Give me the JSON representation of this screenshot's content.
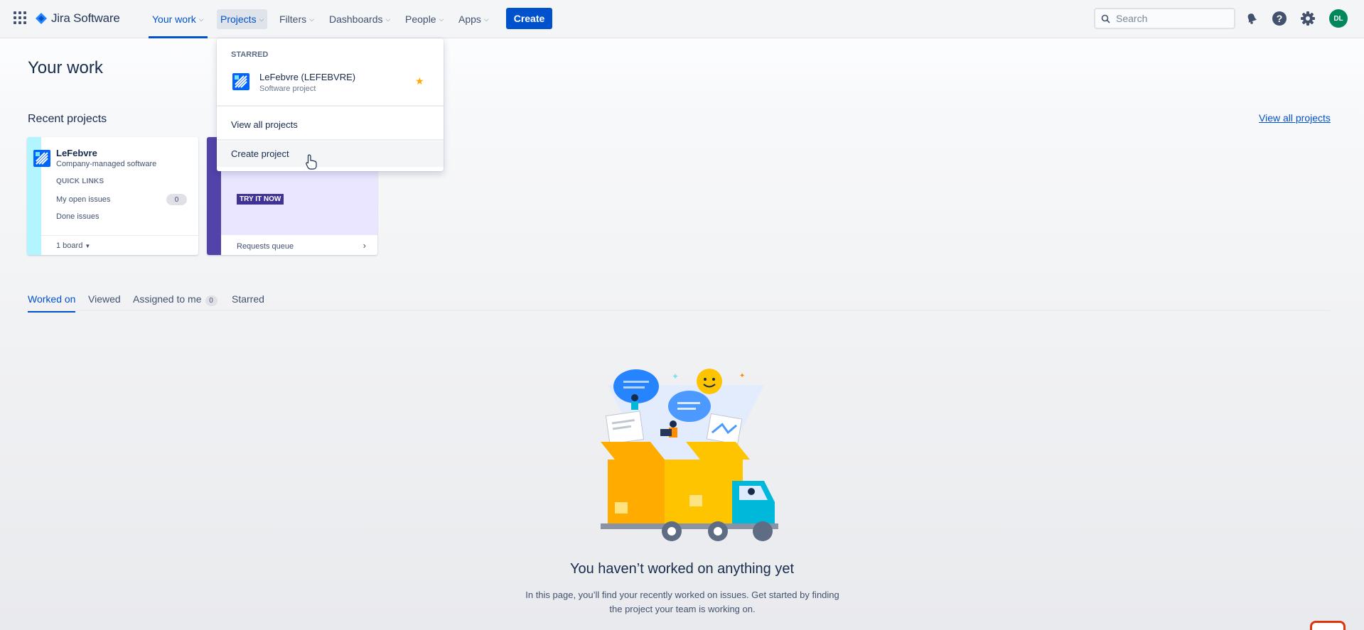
{
  "header": {
    "product_name": "Jira Software",
    "nav": {
      "your_work": "Your work",
      "projects": "Projects",
      "filters": "Filters",
      "dashboards": "Dashboards",
      "people": "People",
      "apps": "Apps"
    },
    "create_label": "Create",
    "search_placeholder": "Search",
    "avatar_initials": "DL"
  },
  "page": {
    "title": "Your work",
    "recent_projects_title": "Recent projects",
    "view_all_projects": "View all projects"
  },
  "project_card": {
    "name": "LeFebvre",
    "type": "Company-managed software",
    "quick_links_heading": "QUICK LINKS",
    "my_open_issues": "My open issues",
    "open_issues_count": "0",
    "done_issues": "Done issues",
    "boards": "1 board"
  },
  "promo_card": {
    "cta": "TRY IT NOW",
    "footer": "Requests queue"
  },
  "tabs": {
    "worked_on": "Worked on",
    "viewed": "Viewed",
    "assigned_to_me": "Assigned to me",
    "assigned_count": "0",
    "starred": "Starred"
  },
  "empty_state": {
    "title": "You haven’t worked on anything yet",
    "description": "In this page, you’ll find your recently worked on issues. Get started by finding the project your team is working on."
  },
  "projects_dropdown": {
    "starred_heading": "STARRED",
    "starred_project_name": "LeFebvre (LEFEBVRE)",
    "starred_project_type": "Software project",
    "view_all_projects": "View all projects",
    "create_project": "Create project"
  },
  "colors": {
    "primary": "#0052cc",
    "text": "#172b4d",
    "star": "#ffab00",
    "promo_purple": "#5243aa",
    "project_strip": "#b3f5ff",
    "avatar": "#00875a"
  }
}
